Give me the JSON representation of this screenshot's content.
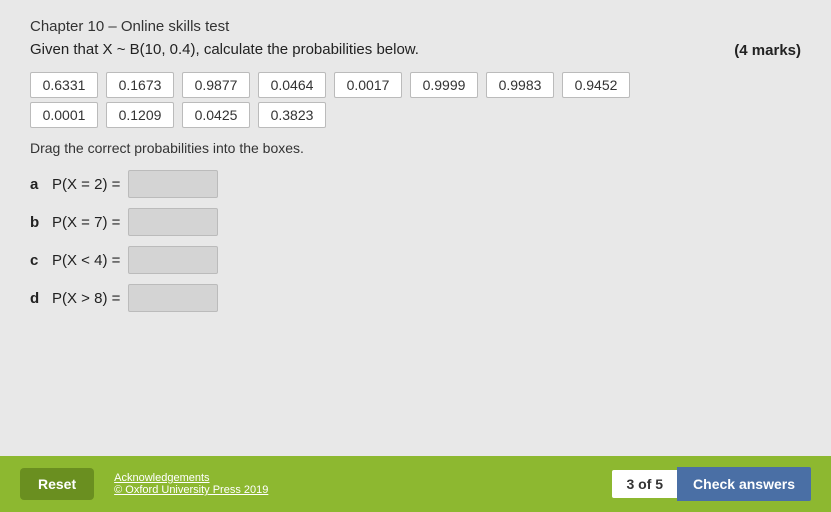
{
  "chapter": {
    "title": "Chapter 10 – Online skills test"
  },
  "question": {
    "text": "Given that X ~ B(10, 0.4), calculate the probabilities below.",
    "marks": "(4 marks)",
    "drag_instruction": "Drag the correct probabilities into the boxes."
  },
  "tiles": {
    "row1": [
      "0.6331",
      "0.1673",
      "0.9877",
      "0.0464",
      "0.0017",
      "0.9999",
      "0.9983",
      "0.9452"
    ],
    "row2": [
      "0.0001",
      "0.1209",
      "0.0425",
      "0.3823"
    ]
  },
  "sub_questions": [
    {
      "label": "a",
      "expr": "P(X = 2) ="
    },
    {
      "label": "b",
      "expr": "P(X = 7) ="
    },
    {
      "label": "c",
      "expr": "P(X < 4) ="
    },
    {
      "label": "d",
      "expr": "P(X > 8) ="
    }
  ],
  "footer": {
    "reset_label": "Reset",
    "acknowledgements_label": "Acknowledgements",
    "copyright_label": "© Oxford University Press 2019",
    "page_indicator": "3 of 5",
    "check_answers_label": "Check answers"
  }
}
